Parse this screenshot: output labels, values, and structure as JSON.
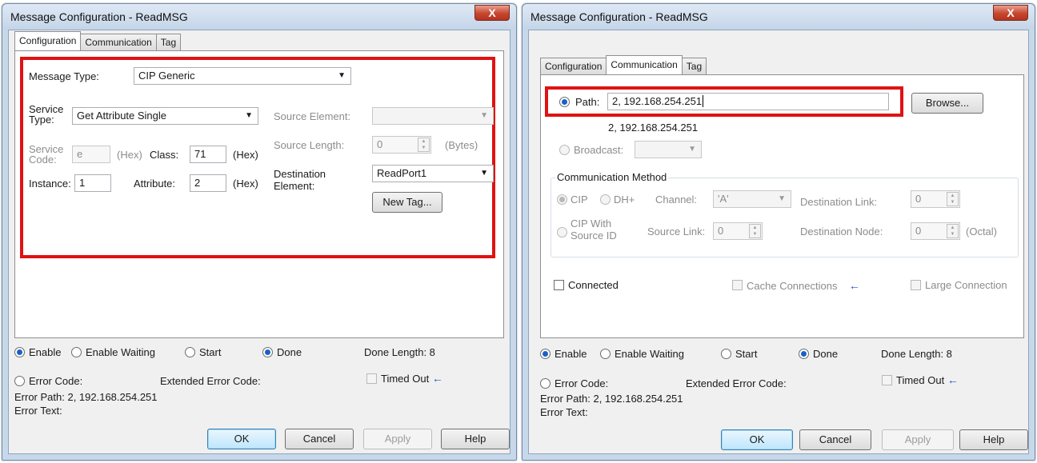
{
  "colors": {
    "highlight_box": "#e01212",
    "radio_selected": "#1b5fc9",
    "close_button": "#c7452e"
  },
  "left_window": {
    "title": "Message Configuration - ReadMSG",
    "close_glyph": "X",
    "tabs": [
      "Configuration",
      "Communication",
      "Tag"
    ],
    "active_tab": "Configuration",
    "config": {
      "message_type_label": "Message Type:",
      "message_type_value": "CIP Generic",
      "service_type_label_1": "Service",
      "service_type_label_2": "Type:",
      "service_type_value": "Get Attribute Single",
      "service_code_label_1": "Service",
      "service_code_label_2": "Code:",
      "service_code_value": "e",
      "hex_1": "(Hex)",
      "class_label": "Class:",
      "class_value": "71",
      "hex_2": "(Hex)",
      "instance_label": "Instance:",
      "instance_value": "1",
      "attribute_label": "Attribute:",
      "attribute_value": "2",
      "hex_3": "(Hex)",
      "source_element_label": "Source Element:",
      "source_element_value": "",
      "source_length_label": "Source Length:",
      "source_length_value": "0",
      "bytes_label": "(Bytes)",
      "destination_label_1": "Destination",
      "destination_label_2": "Element:",
      "destination_value": "ReadPort1",
      "new_tag_button": "New Tag..."
    },
    "status": {
      "enable": "Enable",
      "enable_waiting": "Enable Waiting",
      "start": "Start",
      "done": "Done",
      "done_length": "Done Length: 8",
      "error_code": "Error Code:",
      "extended_error_code": "Extended Error Code:",
      "timed_out": "Timed Out",
      "timed_out_arrow": "←",
      "error_path": "Error Path: 2, 192.168.254.251",
      "error_text": "Error Text:"
    },
    "buttons": {
      "ok": "OK",
      "cancel": "Cancel",
      "apply": "Apply",
      "help": "Help"
    }
  },
  "right_window": {
    "title": "Message Configuration - ReadMSG",
    "close_glyph": "X",
    "tabs": [
      "Configuration",
      "Communication",
      "Tag"
    ],
    "active_tab": "Communication",
    "comm": {
      "path_label": "Path:",
      "path_value": "2, 192.168.254.251",
      "path_resolved": "2, 192.168.254.251",
      "browse_button": "Browse...",
      "broadcast_label": "Broadcast:",
      "broadcast_value": "",
      "comm_method_label": "Communication Method",
      "cip": "CIP",
      "dh_plus": "DH+",
      "channel_label": "Channel:",
      "channel_value": "'A'",
      "destination_link_label": "Destination Link:",
      "destination_link_value": "0",
      "cip_with_1": "CIP With",
      "cip_with_2": "Source ID",
      "source_link_label": "Source Link:",
      "source_link_value": "0",
      "destination_node_label": "Destination Node:",
      "destination_node_value": "0",
      "octal_label": "(Octal)",
      "connected": "Connected",
      "cache_connections": "Cache Connections",
      "cache_arrow": "←",
      "large_connection": "Large Connection"
    },
    "status": {
      "enable": "Enable",
      "enable_waiting": "Enable Waiting",
      "start": "Start",
      "done": "Done",
      "done_length": "Done Length: 8",
      "error_code": "Error Code:",
      "extended_error_code": "Extended Error Code:",
      "timed_out": "Timed Out",
      "timed_out_arrow": "←",
      "error_path": "Error Path: 2, 192.168.254.251",
      "error_text": "Error Text:"
    },
    "buttons": {
      "ok": "OK",
      "cancel": "Cancel",
      "apply": "Apply",
      "help": "Help"
    }
  }
}
